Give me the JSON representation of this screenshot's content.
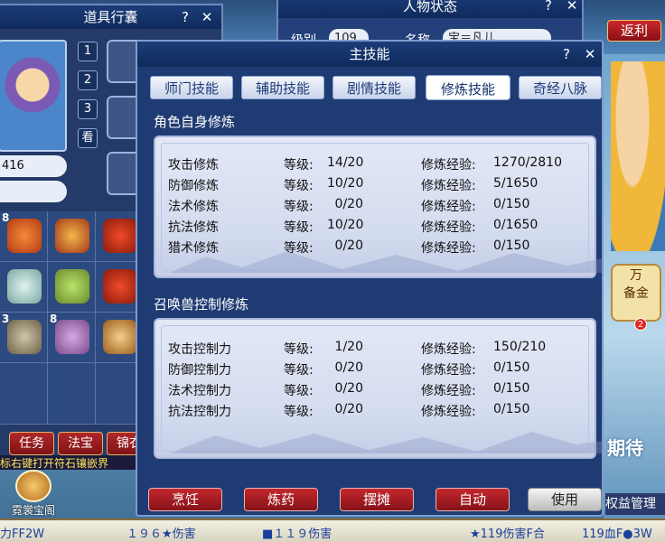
{
  "colors": {
    "window_bg": "#1f3b73",
    "title_bar": "#0f2a5c",
    "panel_bg": "#d3dbef",
    "red_button": "#b0272a",
    "active_tab": "#ffffff"
  },
  "inventory": {
    "title": "道具行囊",
    "help": "?",
    "close": "✕",
    "page_buttons": [
      "1",
      "2",
      "3",
      "看"
    ],
    "gold_value": "416",
    "item_counts": [
      "8",
      "3",
      "8"
    ],
    "tabs": [
      "任务",
      "法宝",
      "锦衣"
    ],
    "ticker": "标右键打开符石镶嵌界",
    "treasure_label": "霓裳宝阁"
  },
  "status_window": {
    "title": "人物状态",
    "help": "?",
    "close": "✕",
    "level_label": "级别",
    "level_value": "109",
    "name_label": "名称",
    "name_value": "宝＝凡儿",
    "fanli": "返利"
  },
  "right_side": {
    "gift_line1": "万",
    "gift_line2": "备金",
    "badge": "2",
    "banner": "期待",
    "shouyi": "权益管理"
  },
  "bottom_bar": {
    "items": [
      "力FF2W",
      "１９６★伤害",
      "■１１９伤害",
      "★119伤害F合",
      "119血F●3W"
    ]
  },
  "skill_window": {
    "title": "主技能",
    "help": "?",
    "close": "✕",
    "tabs": [
      "师门技能",
      "辅助技能",
      "剧情技能",
      "修炼技能",
      "奇经八脉"
    ],
    "active_tab": "修炼技能",
    "self_section": {
      "label": "角色自身修炼",
      "rows": [
        {
          "name": "攻击修炼",
          "level_label": "等级:",
          "level": "14/20",
          "exp_label": "修炼经验:",
          "exp": "1270/2810"
        },
        {
          "name": "防御修炼",
          "level_label": "等级:",
          "level": "10/20",
          "exp_label": "修炼经验:",
          "exp": "5/1650"
        },
        {
          "name": "法术修炼",
          "level_label": "等级:",
          "level": "0/20",
          "exp_label": "修炼经验:",
          "exp": "0/150"
        },
        {
          "name": "抗法修炼",
          "level_label": "等级:",
          "level": "10/20",
          "exp_label": "修炼经验:",
          "exp": "0/1650"
        },
        {
          "name": "猎术修炼",
          "level_label": "等级:",
          "level": "0/20",
          "exp_label": "修炼经验:",
          "exp": "0/150"
        }
      ]
    },
    "pet_section": {
      "label": "召唤兽控制修炼",
      "rows": [
        {
          "name": "攻击控制力",
          "level_label": "等级:",
          "level": "1/20",
          "exp_label": "修炼经验:",
          "exp": "150/210"
        },
        {
          "name": "防御控制力",
          "level_label": "等级:",
          "level": "0/20",
          "exp_label": "修炼经验:",
          "exp": "0/150"
        },
        {
          "name": "法术控制力",
          "level_label": "等级:",
          "level": "0/20",
          "exp_label": "修炼经验:",
          "exp": "0/150"
        },
        {
          "name": "抗法控制力",
          "level_label": "等级:",
          "level": "0/20",
          "exp_label": "修炼经验:",
          "exp": "0/150"
        }
      ]
    },
    "buttons": [
      "烹饪",
      "炼药",
      "摆摊",
      "自动",
      "使用"
    ]
  }
}
